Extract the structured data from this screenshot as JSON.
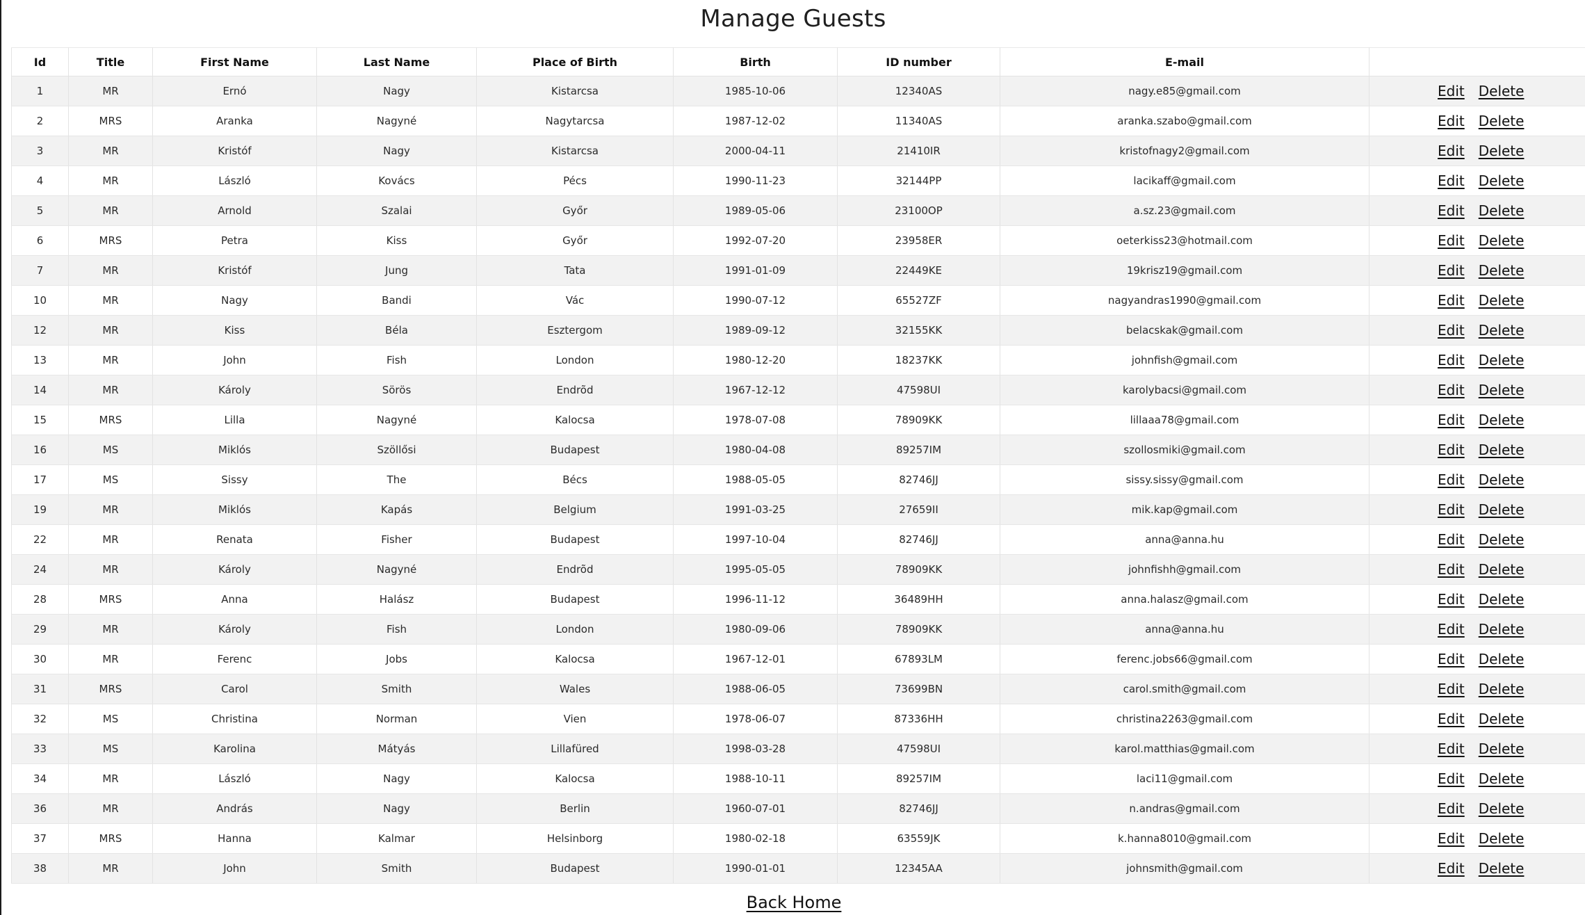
{
  "page": {
    "title": "Manage Guests",
    "back_home_label": "Back Home"
  },
  "table": {
    "columns": [
      "Id",
      "Title",
      "First Name",
      "Last Name",
      "Place of Birth",
      "Birth",
      "ID number",
      "E-mail",
      ""
    ],
    "edit_label": "Edit",
    "delete_label": "Delete",
    "rows": [
      [
        "1",
        "MR",
        "Ernó",
        "Nagy",
        "Kistarcsa",
        "1985-10-06",
        "12340AS",
        "nagy.e85@gmail.com"
      ],
      [
        "2",
        "MRS",
        "Aranka",
        "Nagyné",
        "Nagytarcsa",
        "1987-12-02",
        "11340AS",
        "aranka.szabo@gmail.com"
      ],
      [
        "3",
        "MR",
        "Kristóf",
        "Nagy",
        "Kistarcsa",
        "2000-04-11",
        "21410IR",
        "kristofnagy2@gmail.com"
      ],
      [
        "4",
        "MR",
        "László",
        "Kovács",
        "Pécs",
        "1990-11-23",
        "32144PP",
        "lacikaff@gmail.com"
      ],
      [
        "5",
        "MR",
        "Arnold",
        "Szalai",
        "Győr",
        "1989-05-06",
        "23100OP",
        "a.sz.23@gmail.com"
      ],
      [
        "6",
        "MRS",
        "Petra",
        "Kiss",
        "Győr",
        "1992-07-20",
        "23958ER",
        "oeterkiss23@hotmail.com"
      ],
      [
        "7",
        "MR",
        "Kristóf",
        "Jung",
        "Tata",
        "1991-01-09",
        "22449KE",
        "19krisz19@gmail.com"
      ],
      [
        "10",
        "MR",
        "Nagy",
        "Bandi",
        "Vác",
        "1990-07-12",
        "65527ZF",
        "nagyandras1990@gmail.com"
      ],
      [
        "12",
        "MR",
        "Kiss",
        "Béla",
        "Esztergom",
        "1989-09-12",
        "32155KK",
        "belacskak@gmail.com"
      ],
      [
        "13",
        "MR",
        "John",
        "Fish",
        "London",
        "1980-12-20",
        "18237KK",
        "johnfish@gmail.com"
      ],
      [
        "14",
        "MR",
        "Károly",
        "Sörös",
        "Endrõd",
        "1967-12-12",
        "47598UI",
        "karolybacsi@gmail.com"
      ],
      [
        "15",
        "MRS",
        "Lilla",
        "Nagyné",
        "Kalocsa",
        "1978-07-08",
        "78909KK",
        "lillaaa78@gmail.com"
      ],
      [
        "16",
        "MS",
        "Miklós",
        "Szöllősi",
        "Budapest",
        "1980-04-08",
        "89257IM",
        "szollosmiki@gmail.com"
      ],
      [
        "17",
        "MS",
        "Sissy",
        "The",
        "Bécs",
        "1988-05-05",
        "82746JJ",
        "sissy.sissy@gmail.com"
      ],
      [
        "19",
        "MR",
        "Miklós",
        "Kapás",
        "Belgium",
        "1991-03-25",
        "27659II",
        "mik.kap@gmail.com"
      ],
      [
        "22",
        "MR",
        "Renata",
        "Fisher",
        "Budapest",
        "1997-10-04",
        "82746JJ",
        "anna@anna.hu"
      ],
      [
        "24",
        "MR",
        "Károly",
        "Nagyné",
        "Endrõd",
        "1995-05-05",
        "78909KK",
        "johnfishh@gmail.com"
      ],
      [
        "28",
        "MRS",
        "Anna",
        "Halász",
        "Budapest",
        "1996-11-12",
        "36489HH",
        "anna.halasz@gmail.com"
      ],
      [
        "29",
        "MR",
        "Károly",
        "Fish",
        "London",
        "1980-09-06",
        "78909KK",
        "anna@anna.hu"
      ],
      [
        "30",
        "MR",
        "Ferenc",
        "Jobs",
        "Kalocsa",
        "1967-12-01",
        "67893LM",
        "ferenc.jobs66@gmail.com"
      ],
      [
        "31",
        "MRS",
        "Carol",
        "Smith",
        "Wales",
        "1988-06-05",
        "73699BN",
        "carol.smith@gmail.com"
      ],
      [
        "32",
        "MS",
        "Christina",
        "Norman",
        "Vien",
        "1978-06-07",
        "87336HH",
        "christina2263@gmail.com"
      ],
      [
        "33",
        "MS",
        "Karolina",
        "Mátyás",
        "Lillafüred",
        "1998-03-28",
        "47598UI",
        "karol.matthias@gmail.com"
      ],
      [
        "34",
        "MR",
        "László",
        "Nagy",
        "Kalocsa",
        "1988-10-11",
        "89257IM",
        "laci11@gmail.com"
      ],
      [
        "36",
        "MR",
        "András",
        "Nagy",
        "Berlin",
        "1960-07-01",
        "82746JJ",
        "n.andras@gmail.com"
      ],
      [
        "37",
        "MRS",
        "Hanna",
        "Kalmar",
        "Helsinborg",
        "1980-02-18",
        "63559JK",
        "k.hanna8010@gmail.com"
      ],
      [
        "38",
        "MR",
        "John",
        "Smith",
        "Budapest",
        "1990-01-01",
        "12345AA",
        "johnsmith@gmail.com"
      ]
    ]
  }
}
